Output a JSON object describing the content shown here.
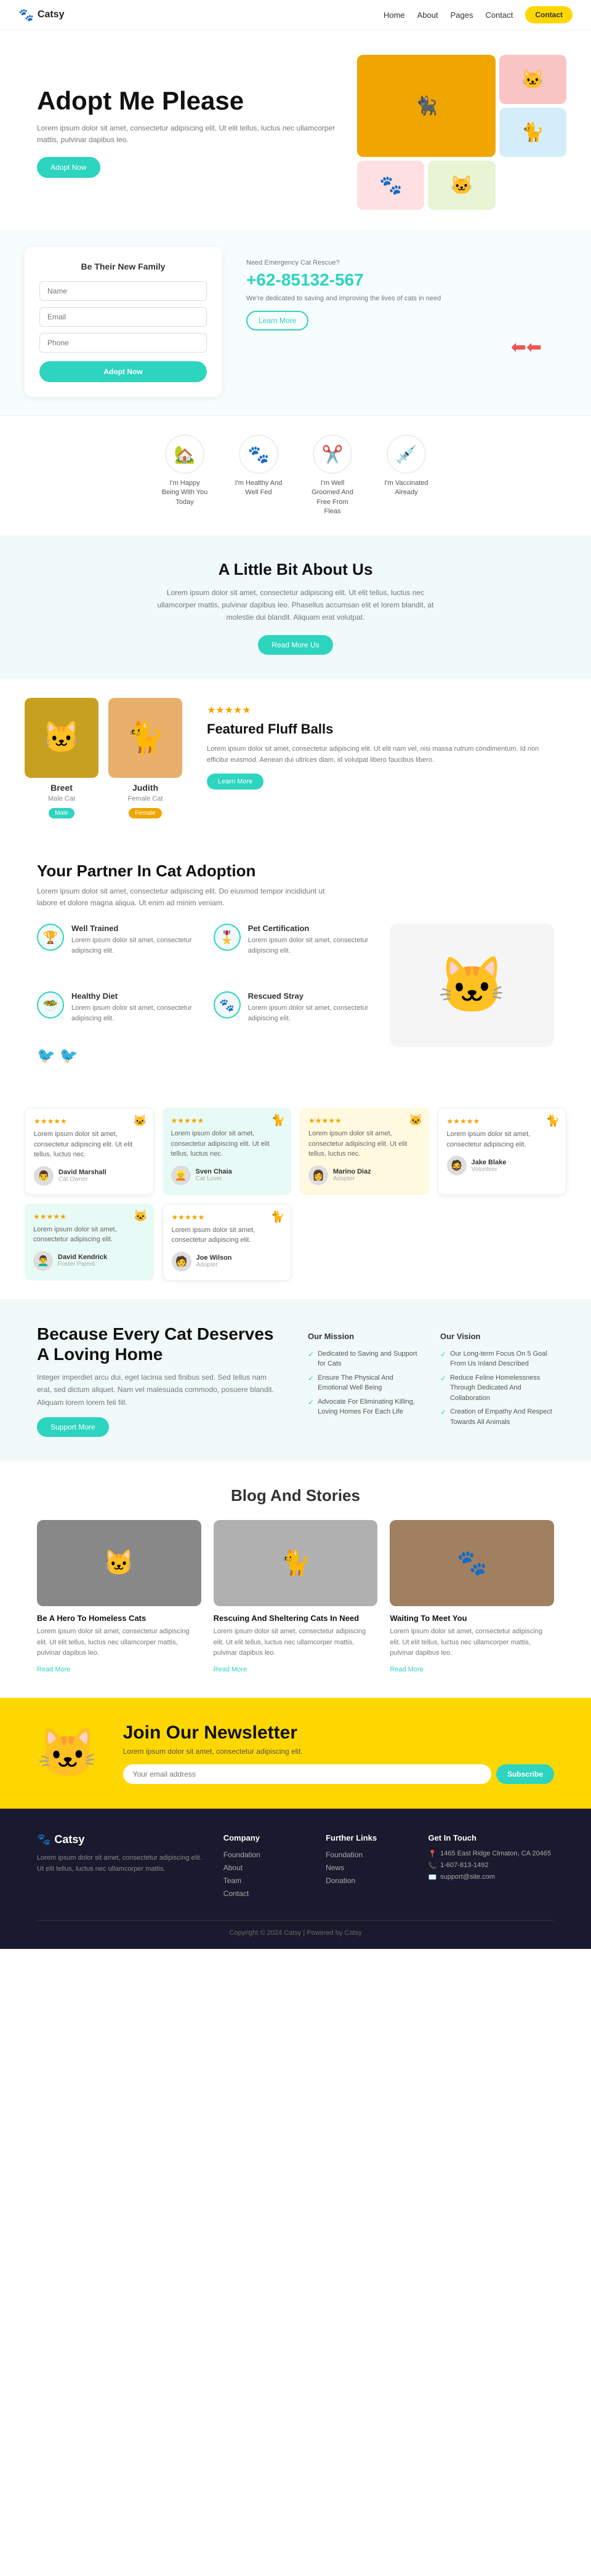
{
  "nav": {
    "logo": "Catsy",
    "paw_icon": "🐾",
    "links": [
      "Home",
      "About",
      "Pages",
      "Contact"
    ],
    "contact_btn": "Contact"
  },
  "hero": {
    "title": "Adopt Me Please",
    "desc": "Lorem ipsum dolor sit amet, consectetur adipiscing elit. Ut elit tellus, luctus nec ullamcorper mattis, pulvinar dapibus leo.",
    "btn": "Adopt Now",
    "deco": "🐦"
  },
  "form": {
    "title": "Be Their New Family",
    "name_placeholder": "Name",
    "email_placeholder": "Email",
    "phone_placeholder": "Phone",
    "btn": "Adopt Now"
  },
  "emergency": {
    "label": "Need Emergency Cat Rescue?",
    "phone": "+62-85132-567",
    "desc": "We're dedicated to saving and improving the lives of cats in need",
    "btn": "Learn More"
  },
  "icons": [
    {
      "icon": "🏡",
      "label": "I'm Happy Being With You Today"
    },
    {
      "icon": "🐾",
      "label": "I'm Healthy And Well Fed"
    },
    {
      "icon": "✂️",
      "label": "I'm Well Groomed And Free From Fleas"
    },
    {
      "icon": "💉",
      "label": "I'm Vaccinated Already"
    }
  ],
  "about": {
    "title": "A Little Bit About Us",
    "desc": "Lorem ipsum dolor sit amet, consectetur adipiscing elit. Ut elit tellus, luctus nec ullamcorper mattis, pulvinar dapibus leo. Phasellus accumsan elit et lorem blandit, at molestie dui blandit. Aliquam erat volutpat.",
    "btn": "Read More Us"
  },
  "featured": {
    "cats": [
      {
        "name": "Breet",
        "gender": "Male Cat",
        "tag": "Male",
        "tagClass": "tag-male",
        "emoji": "🐱",
        "bg": "#c8a020"
      },
      {
        "name": "Judith",
        "gender": "Female Cat",
        "tag": "Female",
        "tagClass": "tag-female",
        "emoji": "🐈",
        "bg": "#e8b06a"
      }
    ],
    "title": "Featured Fluff Balls",
    "stars": "★★★★★",
    "desc": "Lorem ipsum dolor sit amet, consectetur adipiscing elit. Ut elit nam vel, nisi massa rutrum condimentum. Id non efficitur euismod. Aenean dui ultrices diam, id volutpat libero faucibus libero.",
    "btn": "Learn More"
  },
  "partner": {
    "title": "Your Partner In Cat Adoption",
    "sub": "Lorem ipsum dolor sit amet, consectetur adipiscing elit. Do eiusmod tempor incididunt ut labore et dolore magna aliqua. Ut enim ad minim veniam.",
    "features": [
      {
        "icon": "🏆",
        "title": "Well Trained",
        "desc": "Lorem ipsum dolor sit amet, consectetur adipiscing elit."
      },
      {
        "icon": "🎖️",
        "title": "Pet Certification",
        "desc": "Lorem ipsum dolor sit amet, consectetur adipiscing elit."
      },
      {
        "icon": "🥗",
        "title": "Healthy Diet",
        "desc": "Lorem ipsum dolor sit amet, consectetur adipiscing elit."
      },
      {
        "icon": "🐾",
        "title": "Rescued Stray",
        "desc": "Lorem ipsum dolor sit amet, consectetur adipiscing elit."
      }
    ]
  },
  "testimonials": [
    {
      "rating": "★★★★★",
      "text": "Lorem ipsum dolor sit amet, consectetur adipiscing elit. Ut elit tellus, luctus nec.",
      "name": "David Marshall",
      "role": "Cat Owner",
      "emoji": "👨",
      "cat": "🐱",
      "bg": "white"
    },
    {
      "rating": "★★★★★",
      "text": "Lorem ipsum dolor sit amet, consectetur adipiscing elit. Ut elit tellus, luctus nec.",
      "name": "Sven Chaia",
      "role": "Cat Lover",
      "emoji": "👱",
      "cat": "🐈",
      "bg": "green"
    },
    {
      "rating": "★★★★★",
      "text": "Lorem ipsum dolor sit amet, consectetur adipiscing elit. Ut elit tellus, luctus nec.",
      "name": "Marino Diaz",
      "role": "Adopter",
      "emoji": "👩",
      "cat": "🐱",
      "bg": "yellow"
    },
    {
      "rating": "★★★★★",
      "text": "Lorem ipsum dolor sit amet, consectetur adipiscing elit.",
      "name": "Jake Blake",
      "role": "Volunteer",
      "emoji": "🧔",
      "cat": "🐈",
      "bg": "white"
    },
    {
      "rating": "★★★★★",
      "text": "Lorem ipsum dolor sit amet, consectetur adipiscing elit.",
      "name": "David Kendrick",
      "role": "Foster Parent",
      "emoji": "👨‍🦱",
      "cat": "🐱",
      "bg": "green"
    },
    {
      "rating": "★★★★★",
      "text": "Lorem ipsum dolor sit amet, consectetur adipiscing elit.",
      "name": "Joe Wilson",
      "role": "Adopter",
      "emoji": "🧑",
      "cat": "🐈",
      "bg": "white"
    }
  ],
  "every_cat": {
    "title": "Because Every Cat Deserves A Loving Home",
    "desc": "Integer imperdiet arcu dui, eget lacinia sed finibus sed. Sed tellus nam erat, sed dictum aliquet. Nam vel malesuada commodo, posuere blandit. Aliquam lorem lorem feli fill.",
    "btn": "Support More",
    "mission": {
      "title": "Our Mission",
      "items": [
        "Dedicated to Saving and Support for Cats",
        "Ensure The Physical And Emotional Well Being",
        "Advocate For Eliminating Killing, Loving Homes For Each Life"
      ]
    },
    "vision": {
      "title": "Our Vision",
      "items": [
        "Our Long-term Focus On 5 Goal From Us Inland Described",
        "Reduce Feline Homelessness Through Dedicated And Collaboration",
        "Creation of Empathy And Respect Towards All Animals"
      ]
    }
  },
  "blog": {
    "title": "Blog And Stories",
    "posts": [
      {
        "title": "Be A Hero To Homeless Cats",
        "desc": "Lorem ipsum dolor sit amet, consectetur adipiscing elit. Ut elit tellus, luctus nec ullamcorper mattis, pulvinar dapibus leo.",
        "link": "Read More",
        "bg": "cat1",
        "emoji": "🐱"
      },
      {
        "title": "Rescuing And Sheltering Cats In Need",
        "desc": "Lorem ipsum dolor sit amet, consectetur adipiscing elit. Ut elit tellus, luctus nec ullamcorper mattis, pulvinar dapibus leo.",
        "link": "Read More",
        "bg": "cat2",
        "emoji": "🐈"
      },
      {
        "title": "Waiting To Meet You",
        "desc": "Lorem ipsum dolor sit amet, consectetur adipiscing elit. Ut elit tellus, luctus nec ullamcorper mattis, pulvinar dapibus leo.",
        "link": "Read More",
        "bg": "cat3",
        "emoji": "🐾"
      }
    ]
  },
  "newsletter": {
    "cat_emoji": "🐱",
    "title": "Join Our Newsletter",
    "desc": "Lorem ipsum dolor sit amet, consectetur adipiscing elit.",
    "placeholder": "Your email address",
    "btn": "Subscribe"
  },
  "footer": {
    "logo": "Catsy",
    "paw": "🐾",
    "desc": "Lorem ipsum dolor sit amet, consectetur adipiscing elit. Ut elit tellus, luctus nec ullamcorper mattis.",
    "company": {
      "title": "Company",
      "links": [
        "Foundation",
        "About",
        "Team",
        "Contact"
      ]
    },
    "further": {
      "title": "Further Links",
      "links": [
        "Foundation",
        "News",
        "Donation"
      ]
    },
    "contact": {
      "title": "Get In Touch",
      "address": "1465 East Ridge Clmaton, CA 20465",
      "phone": "1-607-813-1492",
      "email": "support@site.com"
    },
    "copyright": "Copyright © 2024 Catsy | Powered by Catsy"
  }
}
